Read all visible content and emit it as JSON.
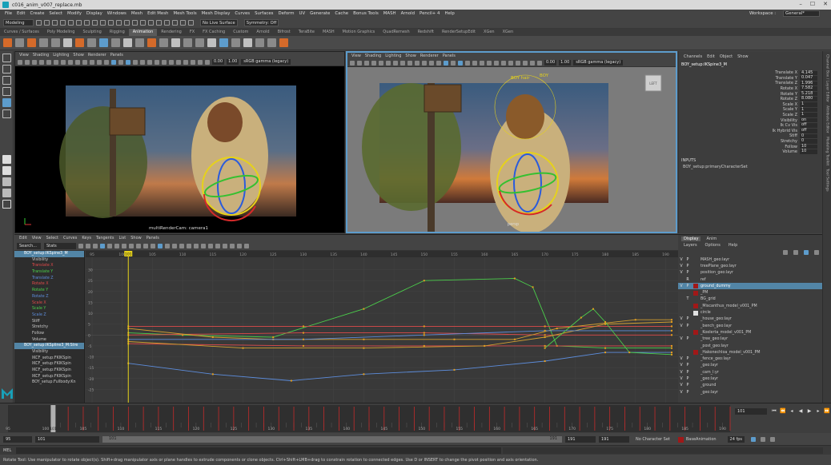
{
  "window": {
    "title": "c016_anim_v007_replace.mb",
    "menus": [
      "File",
      "Edit",
      "Create",
      "Select",
      "Modify",
      "Display",
      "Windows",
      "Mesh",
      "Edit Mesh",
      "Mesh Tools",
      "Mesh Display",
      "Curves",
      "Surfaces",
      "Deform",
      "UV",
      "Generate",
      "Cache",
      "Bonus Tools",
      "MASH",
      "Arnold",
      "Pencil+ 4",
      "Help"
    ],
    "workspace_label": "Workspace :",
    "workspace_value": "General*"
  },
  "status_line": {
    "menu_set": "Modeling",
    "live_surface": "No Live Surface",
    "symmetry": "Symmetry: Off"
  },
  "shelf": {
    "tabs": [
      "Curves / Surfaces",
      "Poly Modeling",
      "Sculpting",
      "Rigging",
      "Animation",
      "Rendering",
      "FX",
      "FX Caching",
      "Custom",
      "Arnold",
      "Bifrost",
      "TeraBite",
      "MASH",
      "Motion Graphics",
      "QuadRemesh",
      "Redshift",
      "RenderSetupEdit",
      "XGen",
      "XGen"
    ],
    "active_tab": "Animation"
  },
  "viewport_left": {
    "menus": [
      "View",
      "Shading",
      "Lighting",
      "Show",
      "Renderer",
      "Panels"
    ],
    "near_value": "0.00",
    "far_value": "1.00",
    "color_space": "sRGB gamma (legacy)",
    "camera_label": "multiRenderCam: camera1"
  },
  "viewport_right": {
    "menus": [
      "View",
      "Shading",
      "Lighting",
      "Show",
      "Renderer",
      "Panels"
    ],
    "near_value": "0.00",
    "far_value": "1.00",
    "color_space": "sRGB gamma (legacy)",
    "labels": [
      "BOY hair",
      "BOY",
      "persp"
    ],
    "view_cube_label": "LEFT"
  },
  "channel_box": {
    "tabs": [
      "Channels",
      "Edit",
      "Object",
      "Show"
    ],
    "node": "BOY_setup:IKSpine3_M",
    "attributes": [
      {
        "name": "Translate X",
        "value": "4.145"
      },
      {
        "name": "Translate Y",
        "value": "0.047"
      },
      {
        "name": "Translate Z",
        "value": "1.996"
      },
      {
        "name": "Rotate X",
        "value": "7.582"
      },
      {
        "name": "Rotate Y",
        "value": "5.218"
      },
      {
        "name": "Rotate Z",
        "value": "8.080"
      },
      {
        "name": "Scale X",
        "value": "1"
      },
      {
        "name": "Scale Y",
        "value": "1"
      },
      {
        "name": "Scale Z",
        "value": "1"
      },
      {
        "name": "Visibility",
        "value": "on"
      },
      {
        "name": "Ik Cv Vis",
        "value": "off"
      },
      {
        "name": "Ik Hybrid Vis",
        "value": "off"
      },
      {
        "name": "Stiff",
        "value": "0"
      },
      {
        "name": "Stretchy",
        "value": "0"
      },
      {
        "name": "Follow",
        "value": "10"
      },
      {
        "name": "Volume",
        "value": "10"
      }
    ],
    "inputs_label": "INPUTS",
    "inputs_value": "BOY_setup:primaryCharacterSet"
  },
  "right_sidebar_tabs": [
    "Channel Box / Layer Editor",
    "Attribute Editor",
    "Modeling Toolkit",
    "Tool Settings"
  ],
  "graph_editor": {
    "menus": [
      "Edit",
      "View",
      "Select",
      "Curves",
      "Keys",
      "Tangents",
      "List",
      "Show",
      "Panels"
    ],
    "search_label": "Stats",
    "search_placeholder": "Search...",
    "outliner_items": [
      {
        "label": "BOY_setup:IKSpine3_M",
        "color": "#ffffff",
        "selected": true
      },
      {
        "label": "Visibility",
        "color": "#c8c8c8"
      },
      {
        "label": "Translate X",
        "color": "#e04a4a"
      },
      {
        "label": "Translate Y",
        "color": "#4bcf4b"
      },
      {
        "label": "Translate Z",
        "color": "#5d8ddc"
      },
      {
        "label": "Rotate X",
        "color": "#e04a4a"
      },
      {
        "label": "Rotate Y",
        "color": "#4bcf4b"
      },
      {
        "label": "Rotate Z",
        "color": "#5d8ddc"
      },
      {
        "label": "Scale X",
        "color": "#e04a4a"
      },
      {
        "label": "Scale Y",
        "color": "#4bcf4b"
      },
      {
        "label": "Scale Z",
        "color": "#5d8ddc"
      },
      {
        "label": "Stiff",
        "color": "#c8c8c8"
      },
      {
        "label": "Stretchy",
        "color": "#c8c8c8"
      },
      {
        "label": "Follow",
        "color": "#c8c8c8"
      },
      {
        "label": "Volume",
        "color": "#c8c8c8"
      },
      {
        "label": "BOY_setup:IKSpline3_M:Stre",
        "color": "#ffffff",
        "selected": true
      },
      {
        "label": "Visibility",
        "color": "#c8c8c8"
      },
      {
        "label": "IKCF_setup:FKIKSpin",
        "color": "#c8c8c8"
      },
      {
        "label": "IKCF_setup:FKIKSpin",
        "color": "#c8c8c8"
      },
      {
        "label": "IKCF_setup:FKIKSpin",
        "color": "#c8c8c8"
      },
      {
        "label": "IKCF_setup:FKIKSpin",
        "color": "#c8c8c8"
      },
      {
        "label": "BOY_setup:Fullbody:Kn",
        "color": "#c8c8c8"
      }
    ],
    "frame_ticks": [
      "95",
      "100",
      "105",
      "110",
      "115",
      "120",
      "125",
      "130",
      "135",
      "140",
      "145",
      "150",
      "155",
      "160",
      "165",
      "170",
      "175",
      "180",
      "185",
      "190"
    ],
    "value_ticks": [
      "30",
      "25",
      "20",
      "15",
      "10",
      "5",
      "0",
      "-5",
      "-10",
      "-15",
      "-20",
      "-25"
    ],
    "current_frame": "101"
  },
  "layer_editor": {
    "tabs": [
      "Display",
      "Anim"
    ],
    "active_tab": "Display",
    "menus": [
      "Layers",
      "Options",
      "Help"
    ],
    "layers": [
      {
        "name": "MASH_geo:layr",
        "color": "",
        "v": "V",
        "p": "P",
        "selected": false
      },
      {
        "name": "treePlane_geo:layr",
        "color": "",
        "v": "V",
        "p": "P",
        "selected": false
      },
      {
        "name": "position_geo:layr",
        "color": "",
        "v": "V",
        "p": "P",
        "selected": false
      },
      {
        "name": "ref",
        "color": "",
        "v": "",
        "p": "R",
        "selected": false
      },
      {
        "name": "ground_dummy",
        "color": "#a01818",
        "v": "V",
        "p": "P",
        "selected": true
      },
      {
        "name": "_PM",
        "color": "#a01818",
        "v": "",
        "p": "",
        "selected": false
      },
      {
        "name": "BG_grid",
        "color": "",
        "v": "",
        "p": "T",
        "selected": false
      },
      {
        "name": "_Miscanthus_model_v001_PM",
        "color": "#a01818",
        "v": "",
        "p": "",
        "selected": false
      },
      {
        "name": "circle",
        "color": "#e0e0e0",
        "v": "",
        "p": "",
        "selected": false
      },
      {
        "name": "_house_geo:layr",
        "color": "",
        "v": "V",
        "p": "P",
        "selected": false
      },
      {
        "name": "_bench_geo:layr",
        "color": "",
        "v": "V",
        "p": "P",
        "selected": false
      },
      {
        "name": "_Koelerta_model_v001_PM",
        "color": "#a01818",
        "v": "",
        "p": "",
        "selected": false
      },
      {
        "name": "_tree_geo:layr",
        "color": "",
        "v": "V",
        "p": "P",
        "selected": false
      },
      {
        "name": "_post_geo:layr",
        "color": "",
        "v": "",
        "p": "",
        "selected": false
      },
      {
        "name": "_Hakonechloa_model_v001_PM",
        "color": "#a01818",
        "v": "",
        "p": "",
        "selected": false
      },
      {
        "name": "_fence_geo:layr",
        "color": "",
        "v": "V",
        "p": "P",
        "selected": false
      },
      {
        "name": "_geo:layr",
        "color": "",
        "v": "V",
        "p": "P",
        "selected": false
      },
      {
        "name": "_cam_l:yr",
        "color": "",
        "v": "V",
        "p": "P",
        "selected": false
      },
      {
        "name": "_geo:layr",
        "color": "",
        "v": "V",
        "p": "P",
        "selected": false
      },
      {
        "name": "_ground",
        "color": "",
        "v": "V",
        "p": "P",
        "selected": false
      },
      {
        "name": "_geo:layr",
        "color": "",
        "v": "V",
        "p": "P",
        "selected": false
      }
    ]
  },
  "time_slider": {
    "ticks": [
      "95",
      "100",
      "105",
      "110",
      "115",
      "120",
      "125",
      "130",
      "135",
      "140",
      "145",
      "150",
      "155",
      "160",
      "165",
      "170",
      "175",
      "180",
      "185",
      "190"
    ],
    "current_frame": "101",
    "current_field": "101"
  },
  "range_slider": {
    "start": "95",
    "playback_start": "101",
    "range_start_label": "101",
    "range_end_label": "191",
    "playback_end": "191",
    "end": "191",
    "character_set": "No Character Set",
    "anim_layer": "BaseAnimation",
    "fps": "24 fps"
  },
  "command_line": {
    "label": "MEL"
  },
  "help_line": {
    "text": "Rotate Tool: Use manipulator to rotate object(s). Shift+drag manipulator axis or plane handles to extrude components or clone objects. Ctrl+Shift+LMB+drag to constrain rotation to connected edges. Use D or INSERT to change the pivot position and axis orientation."
  }
}
